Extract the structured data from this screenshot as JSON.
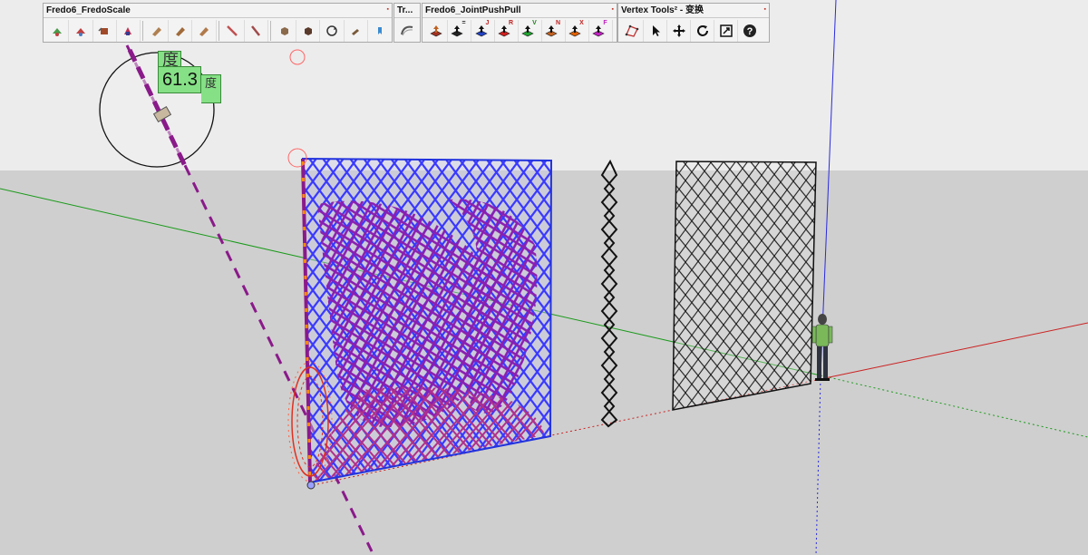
{
  "toolbars": {
    "fredo_scale": {
      "title": "Fredo6_FredoScale",
      "close": "▪"
    },
    "tr": {
      "title": "Tr...",
      "close": "▪"
    },
    "joint_pushpull": {
      "title": "Fredo6_JointPushPull",
      "close": "▪"
    },
    "vertex_tools": {
      "title": "Vertex Tools² - 变换",
      "close": "▪"
    }
  },
  "joint_pushpull_badges": [
    "",
    "=",
    "J",
    "R",
    "V",
    "N",
    "X",
    "F"
  ],
  "protractor": {
    "angle_value": "61.3",
    "angle_top": "度",
    "unit": "度"
  },
  "colors": {
    "sky": "#ececec",
    "ground": "#cfcfcf",
    "axis_red": "#cc2222",
    "axis_green": "#1a9a1a",
    "axis_blue": "#2a2ae0",
    "guide_purple": "#8a1a8a",
    "lattice_blue": "#2233dd",
    "lattice_purple": "#8a20a8"
  },
  "icons": [
    "scale-icon",
    "rotate-icon",
    "stretch-icon",
    "twist-icon",
    "shear-icon",
    "bend-icon",
    "taper-icon",
    "fold-icon",
    "planar-icon",
    "box-icon",
    "repeat-icon",
    "hand-icon",
    "bookmark-icon",
    "curve-icon",
    "select-vertex-icon",
    "arrow-cursor-icon",
    "move-icon",
    "rotate-arrows-icon",
    "scale-box-icon",
    "help-icon"
  ]
}
